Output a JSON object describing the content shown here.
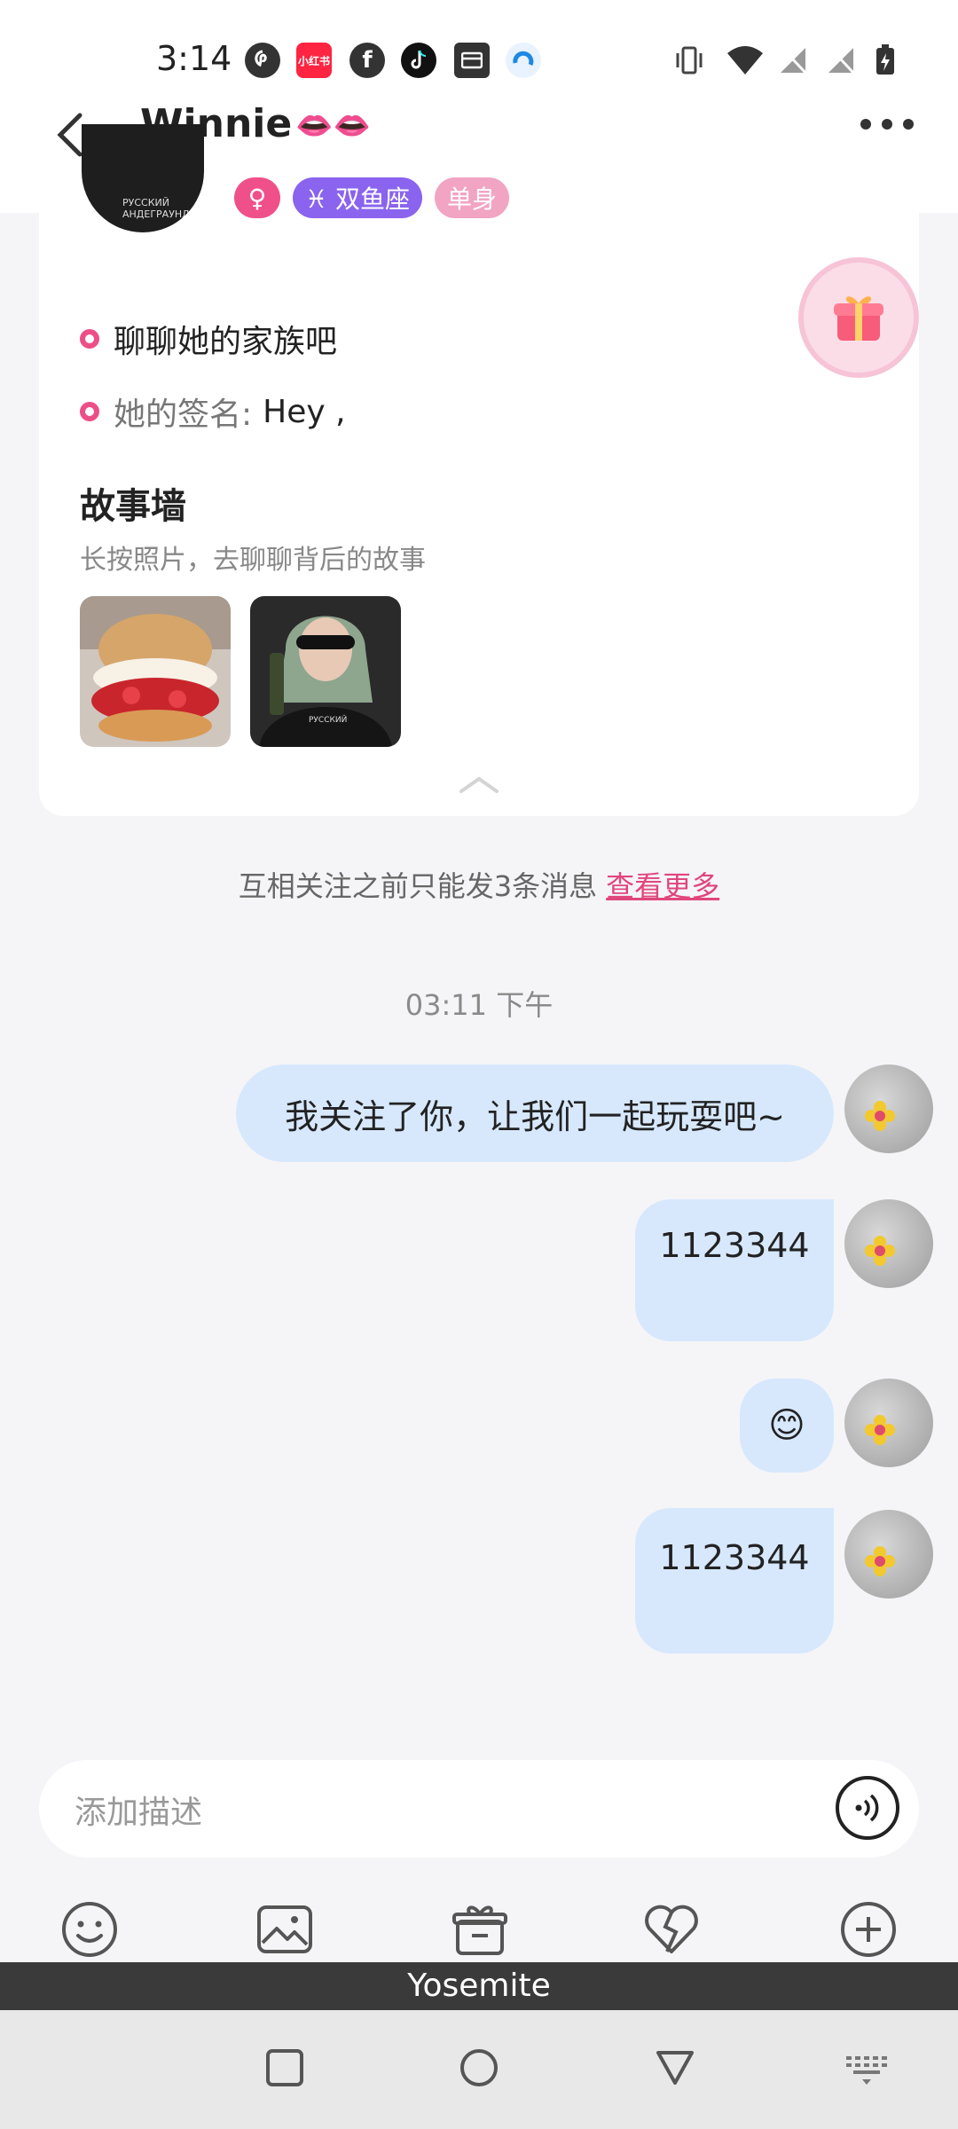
{
  "status_bar": {
    "time": "3:14",
    "apps": [
      "pinterest-icon",
      "xiaohongshu-icon",
      "facebook-icon",
      "tiktok-icon",
      "wallet-icon",
      "browser-icon"
    ],
    "xiaohongshu_label": "小红书"
  },
  "header": {
    "title": "Winnie",
    "title_emoji": "👄👄"
  },
  "profile": {
    "tags": {
      "gender": "♀",
      "zodiac": "♓ 双鱼座",
      "status": "单身"
    },
    "family_prompt": "聊聊她的家族吧",
    "signature_label": "她的签名:",
    "signature_value": "Hey ,",
    "story_title": "故事墙",
    "story_subtitle": "长按照片，去聊聊背后的故事",
    "shirt_text": "РУССКИЙ АНДЕГРАУНД"
  },
  "limit_note": {
    "text": "互相关注之前只能发3条消息",
    "link": "查看更多"
  },
  "timestamp": "03:11 下午",
  "messages": [
    {
      "text": "我关注了你，让我们一起玩耍吧~"
    },
    {
      "text": "1123344"
    },
    {
      "text": "😊"
    },
    {
      "text": "1123344"
    }
  ],
  "input": {
    "placeholder": "添加描述"
  },
  "toolbar": [
    "emoji-icon",
    "image-icon",
    "gift-icon",
    "heart-broken-icon",
    "add-icon"
  ],
  "keyboard_label": "Yosemite",
  "colors": {
    "accent_pink": "#ec4f86",
    "bubble_blue": "#d7e8fd",
    "zodiac_purple": "#8a63ee"
  }
}
